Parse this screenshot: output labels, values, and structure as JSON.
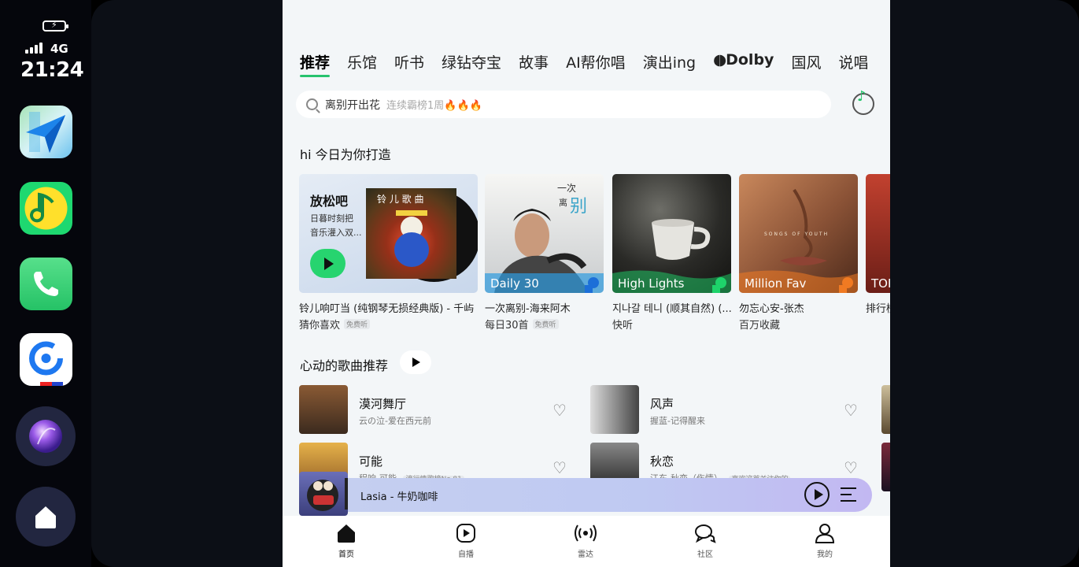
{
  "status": {
    "network": "4G",
    "time": "21:24",
    "battery_icon": "battery-charging-icon",
    "signal_icon": "signal-bars-icon"
  },
  "dock": {
    "apps": [
      {
        "name": "maps",
        "icon": "navigation-arrow-icon"
      },
      {
        "name": "qq-music",
        "icon": "music-note-icon"
      },
      {
        "name": "phone",
        "icon": "phone-icon"
      },
      {
        "name": "browser",
        "icon": "c-logo-icon"
      }
    ],
    "siri_icon": "siri-orb-icon",
    "home_icon": "home-icon"
  },
  "tabs": [
    {
      "label": "推荐",
      "active": true
    },
    {
      "label": "乐馆"
    },
    {
      "label": "听书"
    },
    {
      "label": "绿钻夺宝"
    },
    {
      "label": "故事"
    },
    {
      "label": "AI帮你唱"
    },
    {
      "label": "演出ing"
    },
    {
      "label": "Dolby"
    },
    {
      "label": "国风"
    },
    {
      "label": "说唱"
    }
  ],
  "search": {
    "hot_query": "离别开出花",
    "subtitle": "连续霸榜1周🔥🔥🔥"
  },
  "sections": {
    "daily_title": "hi 今日为你打造",
    "songs_title": "心动的歌曲推荐"
  },
  "cards": [
    {
      "overlay_title": "放松吧",
      "overlay_desc_1": "日暮时刻把",
      "overlay_desc_2": "音乐灌入双...",
      "title": "铃儿响叮当 (纯钢琴无损经典版) - 千屿",
      "subtitle": "猜你喜欢",
      "badge": "免费听"
    },
    {
      "cover_tag": "Daily 30",
      "title": "一次离别-海来阿木",
      "subtitle": "每日30首",
      "badge": "免费听",
      "accent": "#2e9be0"
    },
    {
      "cover_tag": "High Lights",
      "title": "지나갈 테니 (顺其自然) (...",
      "subtitle": "快听",
      "accent": "#1ed36a"
    },
    {
      "cover_tag": "Million Fav",
      "title": "勿忘心安-张杰",
      "subtitle": "百万收藏",
      "accent": "#f07a22"
    },
    {
      "cover_tag": "TOP",
      "title": "排行榜",
      "subtitle": ""
    }
  ],
  "songs": [
    {
      "name": "漠河舞厅",
      "artist": "云の泣-爱在西元前",
      "tag": ""
    },
    {
      "name": "风声",
      "artist": "握蓝-记得醒来",
      "tag": ""
    },
    {
      "name": "可能",
      "artist": "程响-可能",
      "tag": "流行情歌榜No.81"
    },
    {
      "name": "秋恋",
      "artist": "江东-秋恋（伤情）",
      "tag": "喜欢这首关注你的"
    }
  ],
  "player": {
    "title": "Lasia - 牛奶咖啡"
  },
  "nav": [
    {
      "label": "首页",
      "icon": "home-icon",
      "active": true
    },
    {
      "label": "自播",
      "icon": "play-square-icon"
    },
    {
      "label": "雷达",
      "icon": "radar-icon"
    },
    {
      "label": "社区",
      "icon": "chat-bubbles-icon"
    },
    {
      "label": "我的",
      "icon": "person-icon"
    }
  ],
  "colors": {
    "accent": "#27c36e",
    "player_gradient_start": "#c6d0f0",
    "player_gradient_end": "#c2b8f2"
  }
}
